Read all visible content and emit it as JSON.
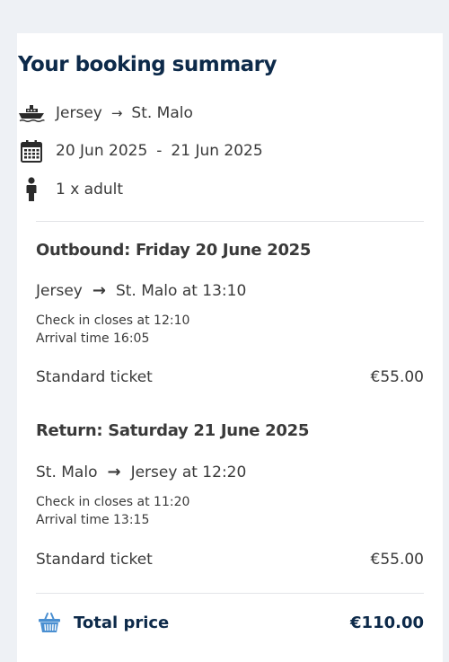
{
  "summary": {
    "title": "Your booking summary",
    "route_from": "Jersey",
    "route_to": "St. Malo",
    "date_from": "20 Jun 2025",
    "date_separator": "-",
    "date_to": "21 Jun 2025",
    "passengers": "1 x adult"
  },
  "outbound": {
    "heading": "Outbound: Friday 20 June 2025",
    "from": "Jersey",
    "to": "St. Malo at 13:10",
    "check_in": "Check in closes at 12:10",
    "arrival": "Arrival time 16:05",
    "ticket_label": "Standard ticket",
    "ticket_price": "€55.00"
  },
  "return": {
    "heading": "Return: Saturday 21 June 2025",
    "from": "St. Malo",
    "to": "Jersey at 12:20",
    "check_in": "Check in closes at 11:20",
    "arrival": "Arrival time 13:15",
    "ticket_label": "Standard ticket",
    "ticket_price": "€55.00"
  },
  "total": {
    "label": "Total price",
    "amount": "€110.00"
  },
  "icons": {
    "ferry": "ferry-icon",
    "calendar": "calendar-icon",
    "person": "person-icon",
    "basket": "basket-icon"
  },
  "colors": {
    "title": "#0d2a4a",
    "text": "#3a3a3a",
    "basket_icon": "#4a8fd1",
    "background": "#eef1f5"
  }
}
